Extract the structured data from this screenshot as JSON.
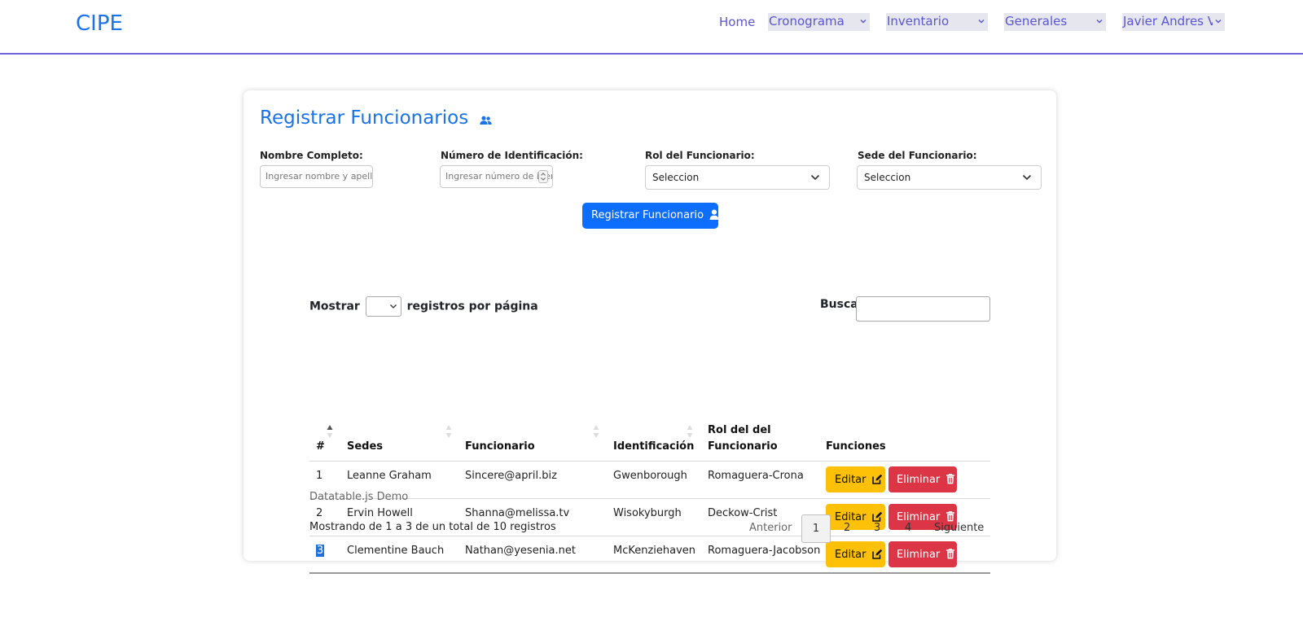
{
  "navbar": {
    "brand": "CIPE",
    "home": "Home",
    "menus": [
      "Cronograma",
      "Inventario",
      "Generales",
      "Javier Andres Vargas"
    ]
  },
  "card": {
    "title": "Registrar Funcionarios",
    "title_icon": "users-icon",
    "form": {
      "name_label": "Nombre Completo:",
      "name_placeholder": "Ingresar nombre y apellido",
      "id_label": "Número de Identificación:",
      "id_placeholder": "Ingresar número de identificación",
      "role_label": "Rol del Funcionario:",
      "role_value": "Seleccion",
      "site_label": "Sede del Funcionario:",
      "site_value": "Seleccion"
    },
    "register_button": "Registrar Funcionario",
    "register_icon": "user-plus-icon"
  },
  "datatable": {
    "length_prefix": "Mostrar",
    "length_suffix": "registros por página",
    "search_label": "Buscar",
    "columns": {
      "num": "#",
      "sedes": "Sedes",
      "funcionario": "Funcionario",
      "identificacion": "Identificación",
      "rol": "Rol del del Funcionario",
      "funciones": "Funciones"
    },
    "rows": [
      {
        "num": "1",
        "sede": "Leanne Graham",
        "funcionario": "Sincere@april.biz",
        "identificacion": "Gwenborough",
        "rol": "Romaguera-Crona"
      },
      {
        "num": "2",
        "sede": "Ervin Howell",
        "funcionario": "Shanna@melissa.tv",
        "identificacion": "Wisokyburgh",
        "rol": "Deckow-Crist"
      },
      {
        "num": "3",
        "sede": "Clementine Bauch",
        "funcionario": "Nathan@yesenia.net",
        "identificacion": "McKenziehaven",
        "rol": "Romaguera-Jacobson"
      }
    ],
    "edit_label": "Editar",
    "delete_label": "Eliminar",
    "caption": "Datatable.js Demo",
    "info": "Mostrando de 1 a 3 de un total de 10 registros",
    "pagination": {
      "previous": "Anterior",
      "pages": [
        "1",
        "2",
        "3",
        "4"
      ],
      "current": "1",
      "next": "Siguiente"
    }
  },
  "colors": {
    "brand": "#1a73e8",
    "nav_text": "#5a54d6",
    "primary": "#0d6efd",
    "warning": "#ffc107",
    "danger": "#dc3545"
  }
}
